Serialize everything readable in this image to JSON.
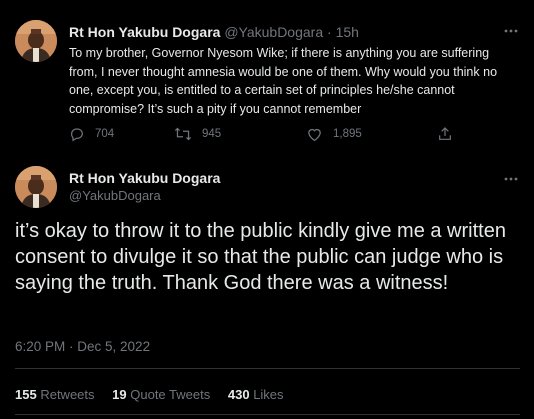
{
  "reply_tweet": {
    "author_name": "Rt Hon Yakubu Dogara",
    "handle": "@YakubDogara",
    "separator": "·",
    "time_ago": "15h",
    "more_icon": "more-dots-icon",
    "text": "To my brother, Governor Nyesom Wike; if there is anything you are suffering from, I never thought amnesia would be one of them. Why would you think no one, except you, is entitled to a certain set of principles he/she cannot compromise? It’s such a pity if you cannot remember",
    "actions": {
      "reply_count": "704",
      "retweet_count": "945",
      "like_count": "1,895",
      "reply_icon": "reply-bubble-icon",
      "retweet_icon": "retweet-icon",
      "like_icon": "heart-icon",
      "share_icon": "share-icon"
    }
  },
  "main_tweet": {
    "author_name": "Rt Hon Yakubu Dogara",
    "handle": "@YakubDogara",
    "more_icon": "more-dots-icon",
    "text": "it’s okay to throw it to the public kindly give me a written consent to divulge it so that the public can judge who is saying the truth. Thank God there was a witness!",
    "timestamp": "6:20 PM · Dec 5, 2022",
    "stats": {
      "retweets_count": "155",
      "retweets_label": "Retweets",
      "quote_tweets_count": "19",
      "quote_tweets_label": "Quote Tweets",
      "likes_count": "430",
      "likes_label": "Likes"
    }
  },
  "colors": {
    "background": "#000000",
    "primary_text": "#e7e9ea",
    "secondary_text": "#71767b",
    "divider": "#2f3336"
  }
}
